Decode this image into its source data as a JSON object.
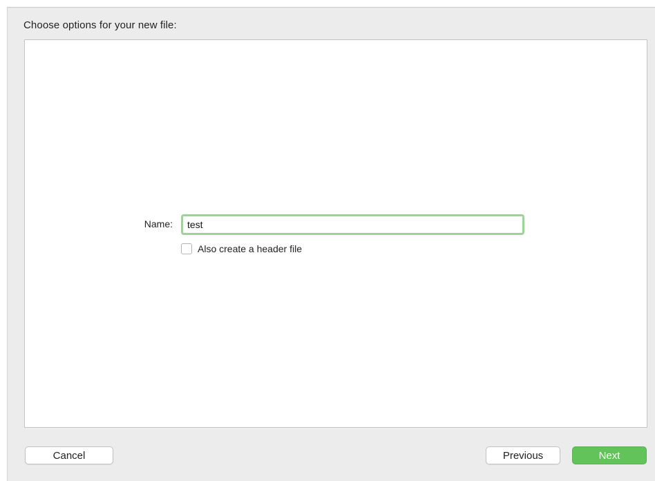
{
  "dialog": {
    "heading": "Choose options for your new file:"
  },
  "form": {
    "name_label": "Name:",
    "name_value": "test",
    "header_checkbox_label": "Also create a header file",
    "header_checkbox_checked": false
  },
  "footer": {
    "cancel_label": "Cancel",
    "previous_label": "Previous",
    "next_label": "Next"
  },
  "colors": {
    "accent_green": "#62c35b",
    "focus_ring": "#9fd29a",
    "sheet_background": "#ececec"
  }
}
